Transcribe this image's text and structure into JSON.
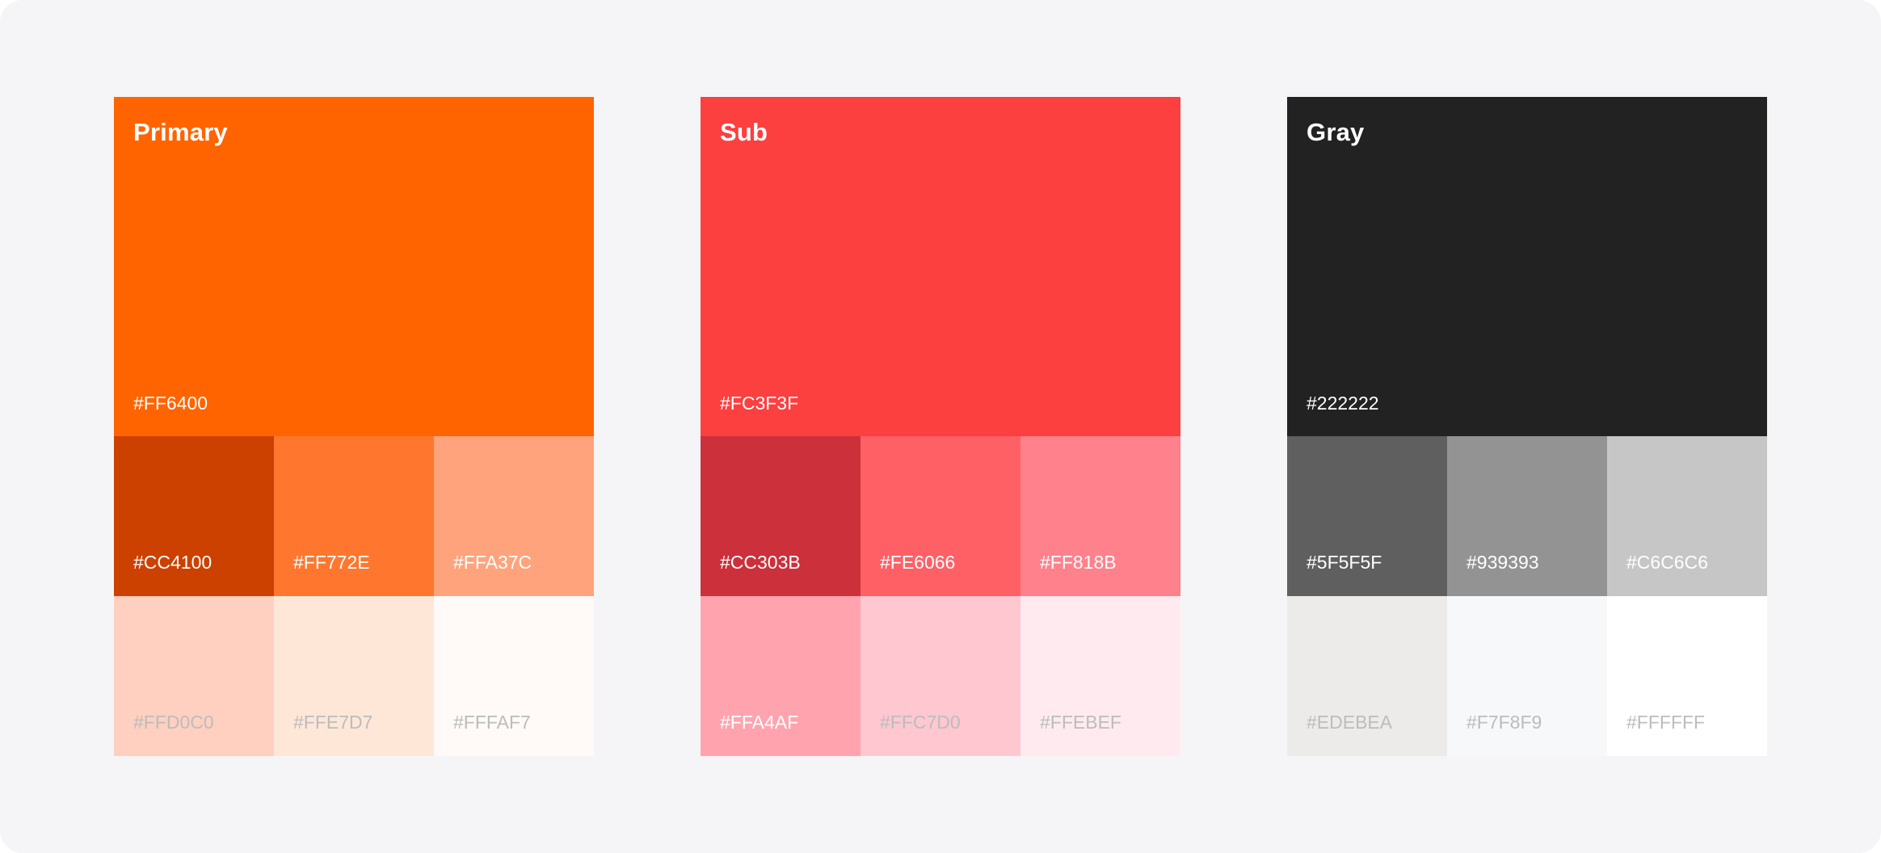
{
  "palettes": [
    {
      "title": "Primary",
      "main": {
        "label": "#FF6400",
        "color": "#FF6400"
      },
      "shades": [
        {
          "label": "#CC4100",
          "color": "#CC4100",
          "light": false
        },
        {
          "label": "#FF772E",
          "color": "#FF772E",
          "light": false
        },
        {
          "label": "#FFA37C",
          "color": "#FFA37C",
          "light": false
        },
        {
          "label": "#FFD0C0",
          "color": "#FFD0C0",
          "light": true
        },
        {
          "label": "#FFE7D7",
          "color": "#FFE7D7",
          "light": true
        },
        {
          "label": "#FFFAF7",
          "color": "#FFFAF7",
          "light": true
        }
      ]
    },
    {
      "title": "Sub",
      "main": {
        "label": "#FC3F3F",
        "color": "#FC3F3F"
      },
      "shades": [
        {
          "label": "#CC303B",
          "color": "#CC303B",
          "light": false
        },
        {
          "label": "#FE6066",
          "color": "#FE6066",
          "light": false
        },
        {
          "label": "#FF818B",
          "color": "#FF818B",
          "light": false
        },
        {
          "label": "#FFA4AF",
          "color": "#FFA4AF",
          "light": false
        },
        {
          "label": "#FFC7D0",
          "color": "#FFC7D0",
          "light": true
        },
        {
          "label": "#FFEBEF",
          "color": "#FFEBEF",
          "light": true
        }
      ]
    },
    {
      "title": "Gray",
      "main": {
        "label": "#222222",
        "color": "#222222"
      },
      "shades": [
        {
          "label": "#5F5F5F",
          "color": "#5F5F5F",
          "light": false
        },
        {
          "label": "#939393",
          "color": "#939393",
          "light": false
        },
        {
          "label": "#C6C6C6",
          "color": "#C6C6C6",
          "light": false
        },
        {
          "label": "#EDEBEA",
          "color": "#EDEBEA",
          "light": true
        },
        {
          "label": "#F7F8F9",
          "color": "#F7F8F9",
          "light": true
        },
        {
          "label": "#FFFFFF",
          "color": "#FFFFFF",
          "light": true
        }
      ]
    }
  ],
  "background_color": "#F5F5F7"
}
